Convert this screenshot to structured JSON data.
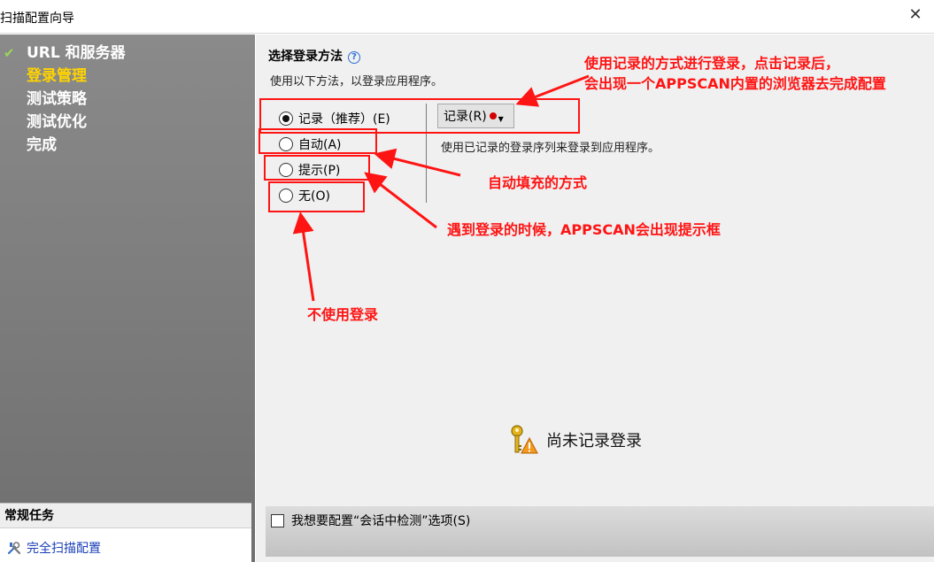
{
  "window": {
    "title": "扫描配置向导",
    "close_icon": "close-icon"
  },
  "sidebar": {
    "steps": [
      {
        "label": "URL 和服务器",
        "done": true
      },
      {
        "label": "登录管理",
        "active": true
      },
      {
        "label": "测试策略"
      },
      {
        "label": "测试优化"
      },
      {
        "label": "完成"
      }
    ],
    "tasks_title": "常规任务",
    "task_link": "完全扫描配置"
  },
  "main": {
    "section_title": "选择登录方法",
    "instruction": "使用以下方法，以登录应用程序。",
    "options": [
      {
        "label": "记录（推荐）(E)",
        "selected": true
      },
      {
        "label": "自动(A)",
        "selected": false
      },
      {
        "label": "提示(P)",
        "selected": false
      },
      {
        "label": "无(O)",
        "selected": false
      }
    ],
    "record_button": "记录(R)",
    "record_desc": "使用已记录的登录序列来登录到应用程序。",
    "status_text": "尚未记录登录",
    "session_checkbox_label": "我想要配置“会话中检测”选项(S)"
  },
  "annotations": {
    "record_note_line1": "使用记录的方式进行登录，点击记录后，",
    "record_note_line2": "会出现一个APPSCAN内置的浏览器去完成配置",
    "auto_note": "自动填充的方式",
    "prompt_note": "遇到登录的时候，APPSCAN会出现提示框",
    "none_note": "不使用登录"
  },
  "colors": {
    "annotation": "#ff1414",
    "active_step": "#ffd400",
    "check": "#9bd45c",
    "link": "#1a3fb8"
  }
}
